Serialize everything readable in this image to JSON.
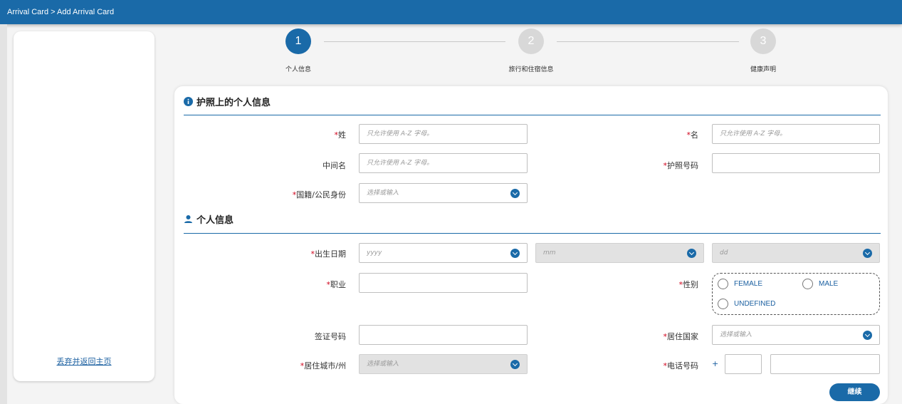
{
  "breadcrumb": "Arrival Card > Add Arrival Card",
  "sidebar": {
    "home_link": "丢弃并返回主页"
  },
  "steps": [
    {
      "number": "1",
      "label": "个人信息",
      "active": true
    },
    {
      "number": "2",
      "label": "旅行和住宿信息",
      "active": false
    },
    {
      "number": "3",
      "label": "健康声明",
      "active": false
    }
  ],
  "passport_section": {
    "title": "护照上的个人信息",
    "surname_label": "姓",
    "surname_placeholder": "只允许使用 A-Z 字母。",
    "given_name_label": "名",
    "given_name_placeholder": "只允许使用 A-Z 字母。",
    "middle_name_label": "中间名",
    "middle_name_placeholder": "只允许使用 A-Z 字母。",
    "passport_no_label": "护照号码",
    "passport_no_value": "",
    "nationality_label": "国籍/公民身份",
    "nationality_placeholder": "选择或输入"
  },
  "personal_section": {
    "title": "个人信息",
    "dob_label": "出生日期",
    "dob_year_placeholder": "yyyy",
    "dob_month_placeholder": "mm",
    "dob_day_placeholder": "dd",
    "occupation_label": "职业",
    "occupation_value": "",
    "gender_label": "性别",
    "gender_options": [
      "FEMALE",
      "MALE",
      "UNDEFINED"
    ],
    "visa_no_label": "签证号码",
    "visa_no_value": "",
    "residence_country_label": "居住国家",
    "residence_country_placeholder": "选择或输入",
    "residence_city_label": "居住城市/州",
    "residence_city_placeholder": "选择或输入",
    "phone_label": "电话号码",
    "phone_prefix": "+",
    "phone_code_value": "",
    "phone_number_value": ""
  },
  "continue_label": "继续",
  "colors": {
    "accent": "#1a6aa8",
    "required": "#d0021b"
  },
  "icons": {
    "info": "info-circle-icon",
    "person": "person-icon",
    "dropdown": "chevron-down-circle-icon"
  }
}
